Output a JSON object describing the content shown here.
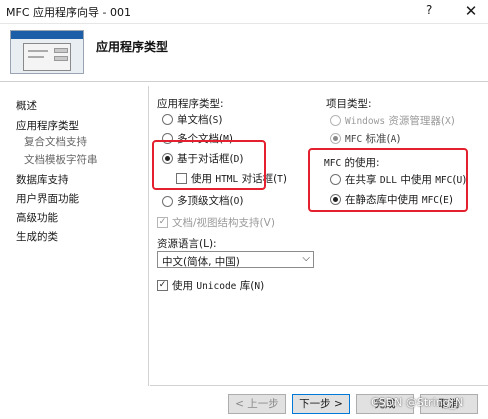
{
  "window": {
    "title": "MFC 应用程序向导 - 001",
    "help_label": "?",
    "close_label": "✕"
  },
  "header": {
    "title": "应用程序类型"
  },
  "sidebar": {
    "items": [
      {
        "label": "概述"
      },
      {
        "label": "应用程序类型"
      },
      {
        "label": "复合文档支持"
      },
      {
        "label": "文档模板字符串"
      },
      {
        "label": "数据库支持"
      },
      {
        "label": "用户界面功能"
      },
      {
        "label": "高级功能"
      },
      {
        "label": "生成的类"
      }
    ]
  },
  "app_type": {
    "label": "应用程序类型:",
    "options": [
      {
        "label": "单文档(",
        "key": "S",
        "close": ")",
        "selected": false
      },
      {
        "label": "多个文档(",
        "key": "M",
        "close": ")",
        "selected": false
      },
      {
        "label": "基于对话框(",
        "key": "D",
        "close": ")",
        "selected": true
      },
      {
        "label": "多顶级文档(",
        "key": "O",
        "close": ")",
        "selected": false
      }
    ],
    "use_html": {
      "pre": "使用 ",
      "mono": "HTML",
      "post": " 对话框(",
      "key": "T",
      "close": ")",
      "checked": false
    },
    "docview": {
      "label": "文档/视图结构支持(V)",
      "checked": true,
      "disabled": true
    }
  },
  "resource_language": {
    "label": "资源语言(L):",
    "value": "中文(简体, 中国)"
  },
  "unicode": {
    "pre": "使用 ",
    "mono": "Unicode",
    "post": " 库(",
    "key": "N",
    "close": ")",
    "checked": true
  },
  "project_type": {
    "label": "项目类型:",
    "options": [
      {
        "mono": "Windows",
        "post": " 资源管理器(",
        "key": "X",
        "close": ")",
        "selected": false,
        "disabled": true
      },
      {
        "mono": "MFC",
        "post": " 标准(",
        "key": "A",
        "close": ")",
        "selected": true,
        "disabled": true
      }
    ]
  },
  "mfc_use": {
    "label_mono": "MFC",
    "label_post": " 的使用:",
    "options": [
      {
        "pre": "在共享 ",
        "mono": "DLL",
        "mid": " 中使用 ",
        "mono2": "MFC",
        "close": "(",
        "key": "U",
        "end": ")",
        "selected": false
      },
      {
        "pre": "在静态库中使用 ",
        "mono": "MFC",
        "close": "(",
        "key": "E",
        "end": ")",
        "selected": true
      }
    ]
  },
  "buttons": {
    "prev": "< 上一步",
    "next": "下一步 >",
    "finish": "完成",
    "cancel": "取消"
  },
  "watermark": "CSDN @String_N",
  "colors": {
    "highlight": "#e4202e",
    "accent": "#0078d7"
  }
}
